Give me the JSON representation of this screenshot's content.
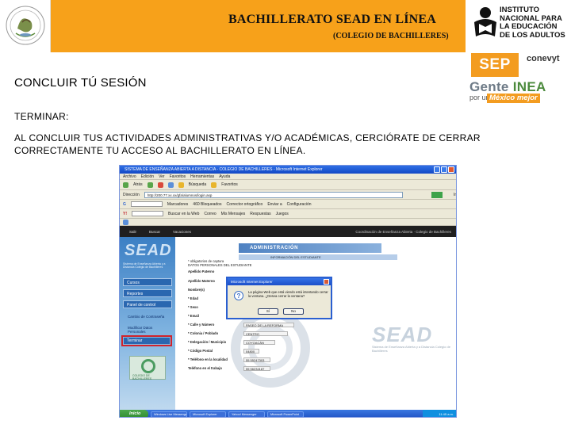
{
  "header": {
    "title": "BACHILLERATO SEAD EN LÍNEA",
    "subtitle": "(COLEGIO DE BACHILLERES)",
    "inea_lines": [
      "INSTITUTO",
      "NACIONAL PARA",
      "LA EDUCACIÓN",
      "DE LOS ADULTOS"
    ],
    "sep": "SEP",
    "conevyt": "conevyt",
    "gente": "Gente",
    "inea": "INEA",
    "por_un": "por un",
    "mexico_mejor": "México mejor",
    "orange": "#f7a11a"
  },
  "content": {
    "heading": "CONCLUIR TÚ SESIÓN",
    "term_label": "TERMINAR:",
    "body": "AL CONCLUIR TUS ACTIVIDADES ADMINISTRATIVAS Y/O ACADÉMICAS, CERCIÓRATE DE CERRAR CORRECTAMENTE TU ACCESO AL BACHILLERATO EN LÍNEA."
  },
  "screenshot": {
    "window_title": "SISTEMA DE ENSEÑANZA ABIERTA A DISTANCIA - COLEGIO DE BACHILLERES - Microsoft Internet Explorer",
    "menu": [
      "Archivo",
      "Edición",
      "Ver",
      "Favoritos",
      "Herramientas",
      "Ayuda"
    ],
    "nav": [
      "Atrás",
      "Búsqueda",
      "Favoritos"
    ],
    "address_label": "Dirección",
    "address_value": "http://200.77.xx.xx/gfa/alumnos/login.asp",
    "go_label": "Ir",
    "toolbar3": [
      "Marcadores",
      "460 Bloqueados",
      "Corrector ortográfico",
      "Enviar a",
      "Configuración"
    ],
    "toolbar4": [
      "Buscar en la Web",
      "Correo",
      "Mis Mensajes",
      "Respuestas",
      "Juegos"
    ],
    "topbar": [
      "Salir",
      "Buscar",
      "Vacaciones"
    ],
    "topbar_right": "Coordinación de Enseñanza Abierta · Colegio de Bachilleres",
    "sead": "SEAD",
    "sead_sub": "Sistema de Enseñanza Abierta y a Distancia Colegio de Bachilleres",
    "left_menu": [
      "Cursos",
      "Reportes",
      "Panel de control"
    ],
    "sub_items": [
      "Cambio de Contraseña",
      "Modificar Datos Personales"
    ],
    "cerrar": "Terminar",
    "qr_text": "COLEGIO DE BACHILLERES",
    "admin_title": "ADMINISTRACIÓN",
    "info_bar": "INFORMACIÓN DEL ESTUDIANTE",
    "form_head": [
      "* obligatorios de captura",
      "DATOS PERSONALES DEL ESTUDIANTE"
    ],
    "fields": [
      {
        "label": "Apellido Paterno",
        "value": ""
      },
      {
        "label": "Apellido Materno",
        "value": ""
      },
      {
        "label": "Nombre(s)",
        "value": ""
      },
      {
        "label": "* Edad",
        "value": ""
      },
      {
        "label": "* Sexo",
        "value": ""
      },
      {
        "label": "* Email",
        "value": "alumno@hotmail.com"
      },
      {
        "label": "* Calle y Número",
        "value": "PASEO DE LA REFORMA"
      },
      {
        "label": "* Colonia / Poblado",
        "value": "CENTRO"
      },
      {
        "label": "* Delegación / Municipio",
        "value": "COYOACÁN"
      },
      {
        "label": "* Código Postal",
        "value": "04800"
      },
      {
        "label": "* Teléfono en la localidad",
        "value": "55 55247303"
      },
      {
        "label": "Teléfono en el trabajo",
        "value": "55 56234187"
      }
    ],
    "dialog": {
      "title": "Microsoft Internet Explorer",
      "q": "?",
      "message": "La página Web que está viendo está intentando cerrar la ventana. ¿Desea cerrar la ventana?",
      "yes": "Sí",
      "no": "No"
    },
    "start": "Inicio",
    "tasks": [
      "Windows Live Messenger",
      "Microsoft Explorer",
      "Yahoo! Messenger",
      "Microsoft PowerPoint"
    ],
    "clock": "11:45 a.m."
  }
}
